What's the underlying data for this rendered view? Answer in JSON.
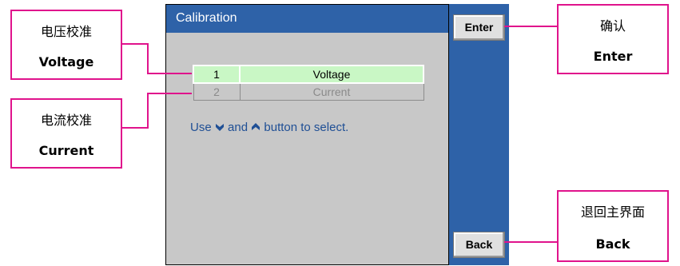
{
  "window": {
    "title": "Calibration"
  },
  "menu": {
    "items": [
      {
        "num": "1",
        "label": "Voltage",
        "selected": true
      },
      {
        "num": "2",
        "label": "Current",
        "selected": false
      }
    ]
  },
  "hint": {
    "prefix": "Use ",
    "middle": " and ",
    "suffix": " button to select."
  },
  "softkeys": {
    "enter": "Enter",
    "back": "Back"
  },
  "callouts": {
    "voltage": {
      "zh": "电压校准",
      "en": "Voltage"
    },
    "current": {
      "zh": "电流校准",
      "en": "Current"
    },
    "enter": {
      "zh": "确认",
      "en": "Enter"
    },
    "back": {
      "zh": "退回主界面",
      "en": "Back"
    }
  },
  "colors": {
    "callout_border": "#e0138c",
    "title_bar": "#2e62a8",
    "selected_row": "#c9f7c5"
  }
}
